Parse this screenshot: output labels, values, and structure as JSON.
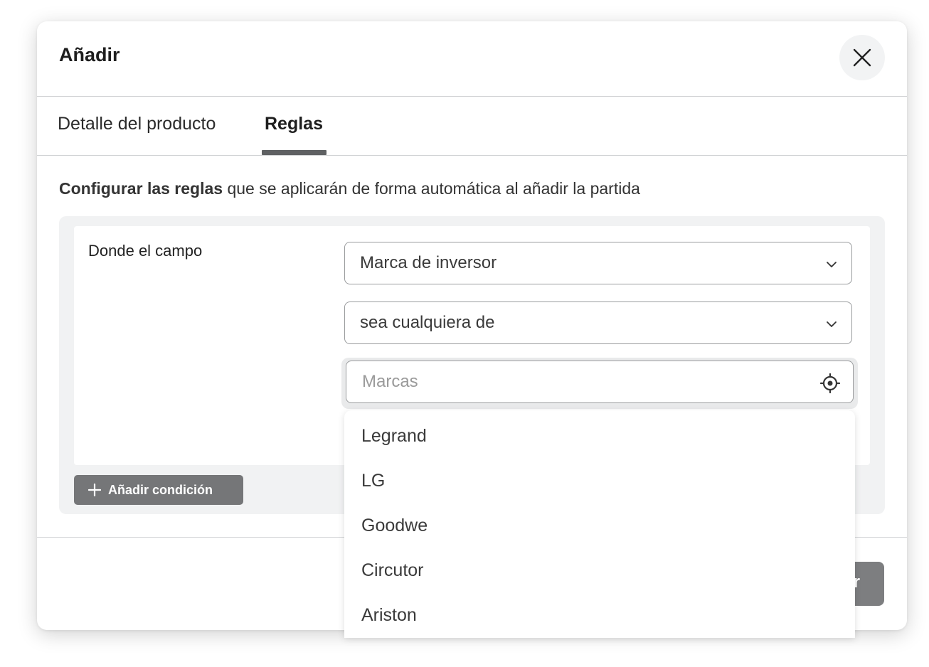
{
  "dialog": {
    "title": "Añadir",
    "close_icon": "close-icon"
  },
  "tabs": [
    {
      "label": "Detalle del producto",
      "active": false
    },
    {
      "label": "Reglas",
      "active": true
    }
  ],
  "intro": {
    "bold": "Configurar las reglas",
    "rest": " que se aplicarán de forma automática al añadir la partida"
  },
  "rule": {
    "label": "Donde el campo",
    "field_select": "Marca de inversor",
    "operator_select": "sea cualquiera de",
    "values_input": {
      "value": "",
      "placeholder": "Marcas",
      "icon": "target-icon"
    }
  },
  "add_condition": {
    "label": "Añadir condición",
    "icon": "plus-icon"
  },
  "footer": {
    "save_label_visible": "r"
  },
  "dropdown": {
    "options": [
      "Legrand",
      "LG",
      "Goodwe",
      "Circutor",
      "Ariston"
    ]
  },
  "colors": {
    "button_gray": "#757678",
    "tab_underline": "#5f6163",
    "panel_bg": "#f1f2f3"
  }
}
